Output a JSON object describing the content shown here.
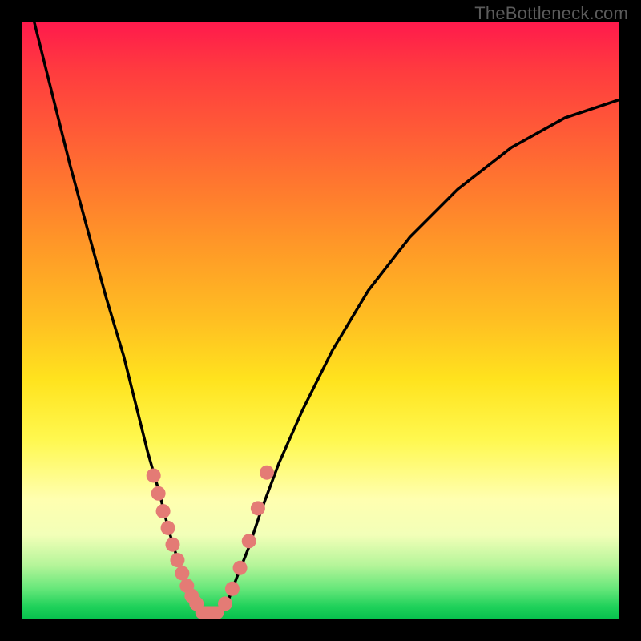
{
  "watermark": "TheBottleneck.com",
  "chart_data": {
    "type": "line",
    "title": "",
    "xlabel": "",
    "ylabel": "",
    "xlim": [
      0,
      100
    ],
    "ylim": [
      0,
      100
    ],
    "series": [
      {
        "name": "left-branch",
        "x": [
          2,
          5,
          8,
          11,
          14,
          17,
          19,
          21,
          23,
          24.5,
          26,
          27.5,
          29,
          30
        ],
        "y": [
          100,
          88,
          76,
          65,
          54,
          44,
          36,
          28,
          21,
          15,
          10,
          6,
          3,
          1
        ]
      },
      {
        "name": "right-branch",
        "x": [
          33,
          34.5,
          36,
          38,
          40,
          43,
          47,
          52,
          58,
          65,
          73,
          82,
          91,
          100
        ],
        "y": [
          1,
          3,
          7,
          12,
          18,
          26,
          35,
          45,
          55,
          64,
          72,
          79,
          84,
          87
        ]
      }
    ],
    "highlight_points_left": {
      "name": "left-highlight-dots",
      "color": "#e47b75",
      "x": [
        22.0,
        22.8,
        23.6,
        24.4,
        25.2,
        26.0,
        26.8,
        27.6,
        28.4,
        29.2
      ],
      "y": [
        24.0,
        21.0,
        18.0,
        15.2,
        12.4,
        9.8,
        7.6,
        5.5,
        3.8,
        2.5
      ]
    },
    "highlight_points_right": {
      "name": "right-highlight-dots",
      "color": "#e47b75",
      "x": [
        34.0,
        35.2,
        36.5,
        38.0,
        39.5,
        41.0
      ],
      "y": [
        2.5,
        5.0,
        8.5,
        13.0,
        18.5,
        24.5
      ]
    },
    "flat_bottom": {
      "name": "flat-bottom-span",
      "x": [
        29.8,
        33.0
      ],
      "y": [
        1,
        1
      ]
    }
  }
}
